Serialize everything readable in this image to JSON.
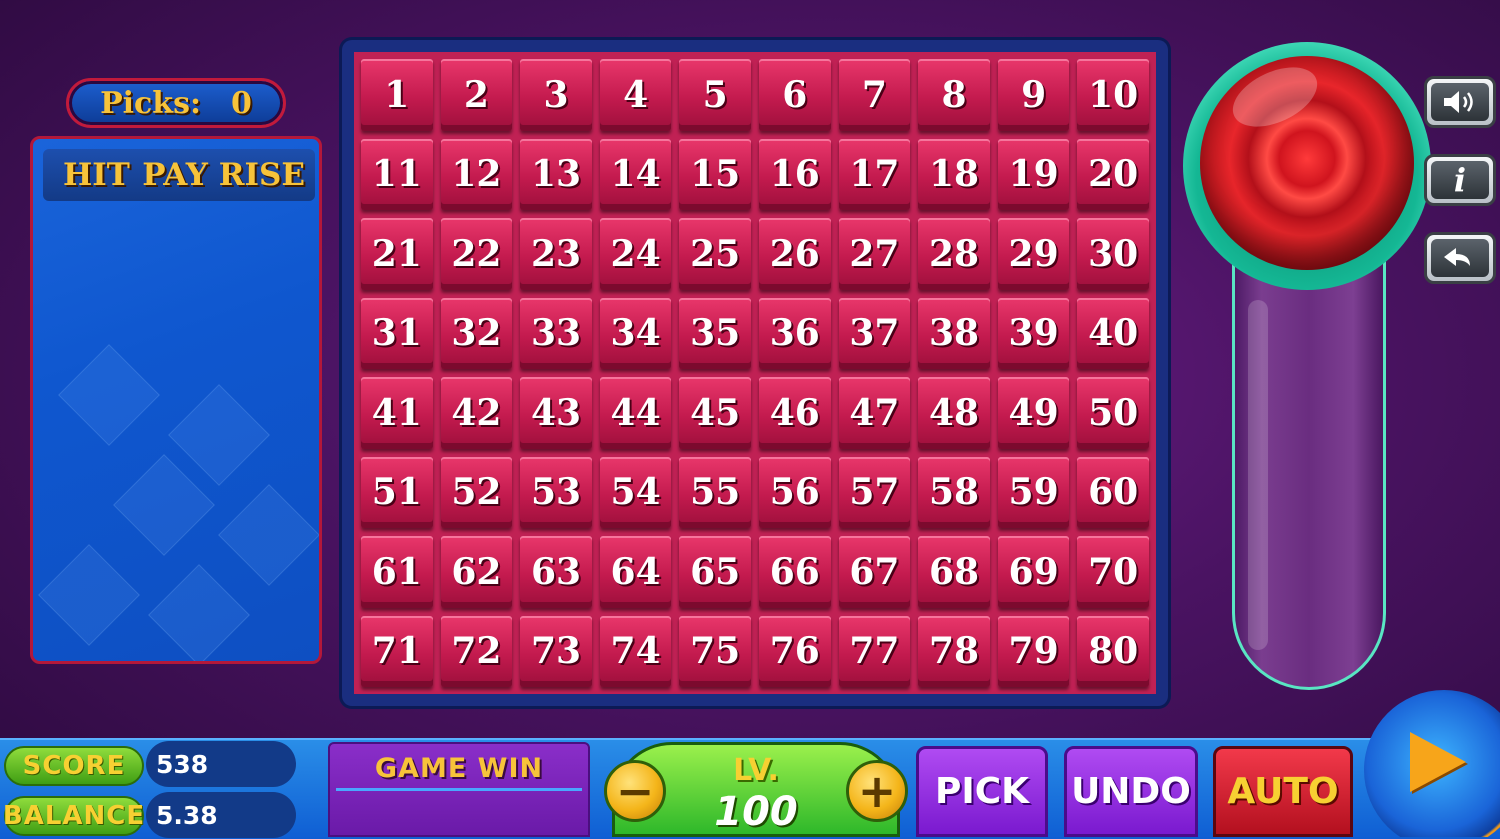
{
  "picks": {
    "label": "Picks:",
    "value": "0"
  },
  "paytable": {
    "headers": [
      "HIT",
      "PAY RISE"
    ]
  },
  "board": {
    "numbers": [
      "1",
      "2",
      "3",
      "4",
      "5",
      "6",
      "7",
      "8",
      "9",
      "10",
      "11",
      "12",
      "13",
      "14",
      "15",
      "16",
      "17",
      "18",
      "19",
      "20",
      "21",
      "22",
      "23",
      "24",
      "25",
      "26",
      "27",
      "28",
      "29",
      "30",
      "31",
      "32",
      "33",
      "34",
      "35",
      "36",
      "37",
      "38",
      "39",
      "40",
      "41",
      "42",
      "43",
      "44",
      "45",
      "46",
      "47",
      "48",
      "49",
      "50",
      "51",
      "52",
      "53",
      "54",
      "55",
      "56",
      "57",
      "58",
      "59",
      "60",
      "61",
      "62",
      "63",
      "64",
      "65",
      "66",
      "67",
      "68",
      "69",
      "70",
      "71",
      "72",
      "73",
      "74",
      "75",
      "76",
      "77",
      "78",
      "79",
      "80"
    ]
  },
  "side_buttons": {
    "icons": [
      "speaker-icon",
      "info-icon",
      "back-arrow-icon"
    ],
    "info_glyph": "i"
  },
  "bottom": {
    "score_label": "SCORE",
    "score_value": "538",
    "balance_label": "BALANCE",
    "balance_value": "5.38",
    "game_win_label": "GAME WIN",
    "game_win_value": "",
    "level_label": "LV.",
    "level_value": "100",
    "minus_glyph": "−",
    "plus_glyph": "+",
    "pick_label": "PICK",
    "undo_label": "UNDO",
    "auto_label": "AUTO"
  },
  "colors": {
    "cell": "#c31a4e",
    "board_frame": "#1a2e80",
    "accent_gold": "#f7c33a",
    "tube_rim": "#59e6c3"
  }
}
